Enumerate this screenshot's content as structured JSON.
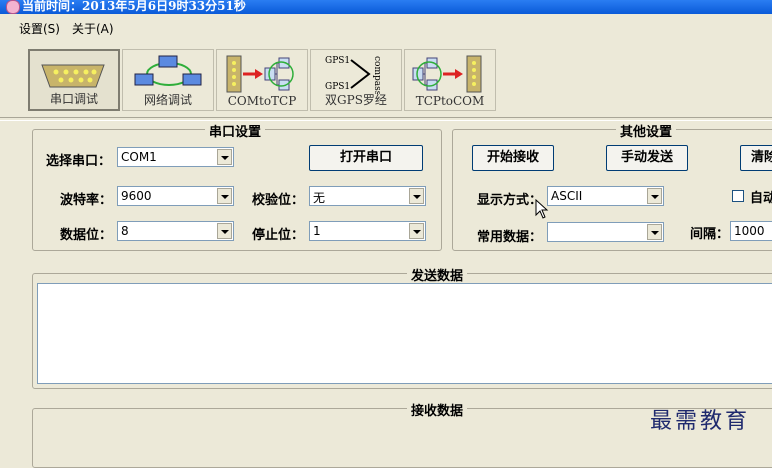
{
  "window": {
    "title": "当前时间：2013年5月6日9时33分51秒"
  },
  "menu": {
    "items": [
      "设置(S)",
      "关于(A)"
    ]
  },
  "toolbar": {
    "tabs": [
      {
        "label": "串口调试",
        "icon": "serial-port-icon",
        "active": true
      },
      {
        "label": "网络调试",
        "icon": "network-icon",
        "active": false
      },
      {
        "label": "COMtoTCP",
        "icon": "com-to-tcp-icon",
        "active": false
      },
      {
        "label": "双GPS罗经",
        "icon": "gps-compass-icon",
        "active": false,
        "icon_text": [
          "GPS1",
          "GPS1",
          "compass"
        ]
      },
      {
        "label": "TCPtoCOM",
        "icon": "tcp-to-com-icon",
        "active": false
      }
    ]
  },
  "serial_settings": {
    "title": "串口设置",
    "port_label": "选择串口：",
    "port_value": "COM1",
    "open_button": "打开串口",
    "baud_label": "波特率：",
    "baud_value": "9600",
    "parity_label": "校验位：",
    "parity_value": "无",
    "databits_label": "数据位：",
    "databits_value": "8",
    "stopbits_label": "停止位：",
    "stopbits_value": "1"
  },
  "other_settings": {
    "title": "其他设置",
    "start_receive_button": "开始接收",
    "manual_send_button": "手动发送",
    "clear_button": "清除",
    "display_mode_label": "显示方式：",
    "display_mode_value": "ASCII",
    "auto_label": "自动",
    "common_data_label": "常用数据：",
    "common_data_value": "",
    "interval_label": "间隔：",
    "interval_value": "1000"
  },
  "send_panel": {
    "title": "发送数据"
  },
  "receive_panel": {
    "title": "接收数据"
  },
  "watermark": "最需教育"
}
